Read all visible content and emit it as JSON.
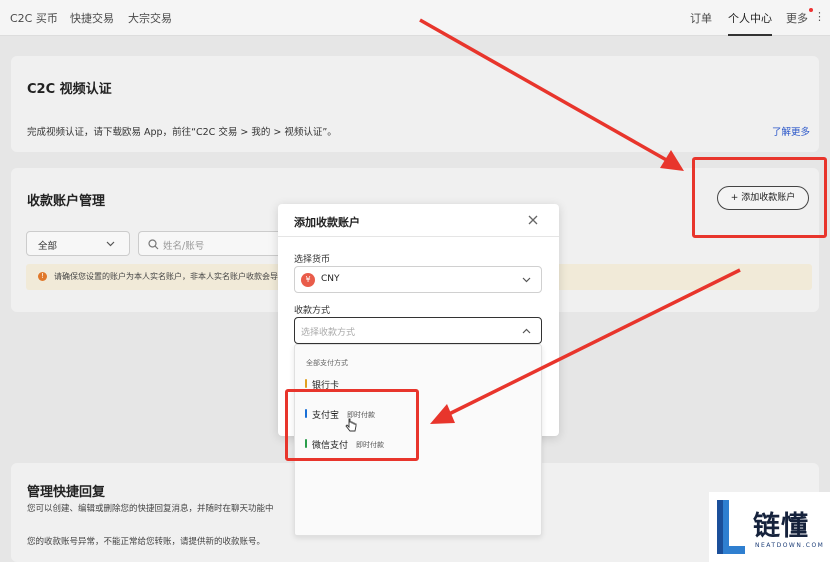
{
  "topnav": {
    "left_items": [
      "C2C 买币",
      "快捷交易",
      "大宗交易"
    ],
    "right_items": [
      "订单",
      "个人中心",
      "更多"
    ],
    "active_item": "个人中心"
  },
  "video_card": {
    "title": "C2C 视频认证",
    "description": "完成视频认证，请下载欧易 App，前往“C2C 交易 > 我的 > 视频认证”。",
    "learn_more": "了解更多"
  },
  "accounts_card": {
    "title": "收款账户管理",
    "add_button": "添加收款账户",
    "filter_select": "全部",
    "search_placeholder": "姓名/账号",
    "warning": "请确保您设置的账户为本人实名账户，非本人实名账户收款会导"
  },
  "reply_card": {
    "title": "管理快捷回复",
    "description": "您可以创建、编辑或删除您的快捷回复消息，并随时在聊天功能中",
    "notice": "您的收款账号异常，不能正常给您转账，请提供新的收款账号。"
  },
  "modal": {
    "title": "添加收款账户",
    "currency_label": "选择货币",
    "currency_value": "CNY",
    "currency_icon_text": "¥",
    "method_label": "收款方式",
    "method_placeholder": "选择收款方式",
    "dropdown_header": "全部支付方式",
    "options": [
      {
        "label": "银行卡",
        "tag": "",
        "color": "#e0a020"
      },
      {
        "label": "支付宝",
        "tag": "即时付款",
        "color": "#1a6fd6"
      },
      {
        "label": "微信支付",
        "tag": "即时付款",
        "color": "#2a9d4a"
      }
    ]
  },
  "watermark": {
    "text": "链懂",
    "subtext": "NEATDOWN.COM"
  },
  "colors": {
    "annotation_red": "#e8352c",
    "accent_link": "#2b57c9"
  }
}
